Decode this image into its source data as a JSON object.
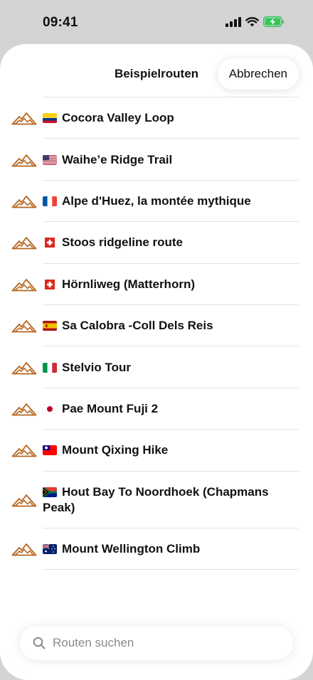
{
  "status_bar": {
    "time": "09:41"
  },
  "sheet": {
    "title": "Beispielrouten",
    "cancel_label": "Abbrechen"
  },
  "routes": [
    {
      "label": "Cocora Valley Loop",
      "flag": "colombia-flag-icon"
    },
    {
      "label": "Waihe’e Ridge Trail",
      "flag": "usa-flag-icon"
    },
    {
      "label": "Alpe d'Huez, la montée mythique",
      "flag": "france-flag-icon"
    },
    {
      "label": "Stoos ridgeline route",
      "flag": "switzerland-flag-icon"
    },
    {
      "label": "Hörnliweg (Matterhorn)",
      "flag": "switzerland-flag-icon"
    },
    {
      "label": "Sa Calobra -Coll Dels Reis",
      "flag": "spain-flag-icon"
    },
    {
      "label": "Stelvio Tour",
      "flag": "italy-flag-icon"
    },
    {
      "label": "Pae Mount Fuji 2",
      "flag": "japan-flag-icon"
    },
    {
      "label": "Mount Qixing Hike",
      "flag": "taiwan-flag-icon"
    },
    {
      "label": "Hout Bay To Noordhoek (Chapmans Peak)",
      "flag": "south-africa-flag-icon"
    },
    {
      "label": "Mount Wellington Climb",
      "flag": "australia-flag-icon"
    }
  ],
  "search": {
    "placeholder": "Routen suchen"
  },
  "colors": {
    "mountain_icon": "#b5651d",
    "battery_charging": "#34c759"
  }
}
